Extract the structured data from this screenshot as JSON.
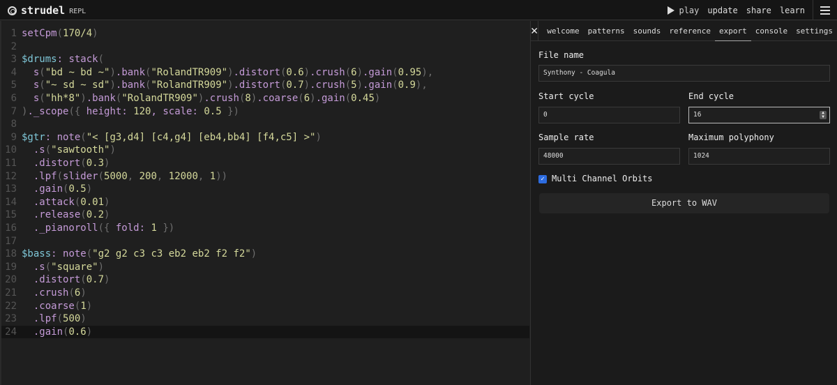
{
  "header": {
    "title": "strudel",
    "subtitle": "REPL",
    "play": "play",
    "update": "update",
    "share": "share",
    "learn": "learn"
  },
  "editor": {
    "lines": [
      [
        [
          "f",
          "setCpm"
        ],
        [
          "p",
          "("
        ],
        [
          "n",
          "170/4"
        ],
        [
          "p",
          ")"
        ]
      ],
      [],
      [
        [
          "l",
          "$drums"
        ],
        [
          "t",
          ": "
        ],
        [
          "f",
          "stack"
        ],
        [
          "p",
          "("
        ]
      ],
      [
        [
          "t",
          "  "
        ],
        [
          "f",
          "s"
        ],
        [
          "p",
          "("
        ],
        [
          "s",
          "\"bd ~ bd ~\""
        ],
        [
          "p",
          ")"
        ],
        [
          "f",
          ".bank"
        ],
        [
          "p",
          "("
        ],
        [
          "s",
          "\"RolandTR909\""
        ],
        [
          "p",
          ")"
        ],
        [
          "f",
          ".distort"
        ],
        [
          "p",
          "("
        ],
        [
          "n",
          "0.6"
        ],
        [
          "p",
          ")"
        ],
        [
          "f",
          ".crush"
        ],
        [
          "p",
          "("
        ],
        [
          "n",
          "6"
        ],
        [
          "p",
          ")"
        ],
        [
          "f",
          ".gain"
        ],
        [
          "p",
          "("
        ],
        [
          "n",
          "0.95"
        ],
        [
          "p",
          "),"
        ]
      ],
      [
        [
          "t",
          "  "
        ],
        [
          "f",
          "s"
        ],
        [
          "p",
          "("
        ],
        [
          "s",
          "\"~ sd ~ sd\""
        ],
        [
          "p",
          ")"
        ],
        [
          "f",
          ".bank"
        ],
        [
          "p",
          "("
        ],
        [
          "s",
          "\"RolandTR909\""
        ],
        [
          "p",
          ")"
        ],
        [
          "f",
          ".distort"
        ],
        [
          "p",
          "("
        ],
        [
          "n",
          "0.7"
        ],
        [
          "p",
          ")"
        ],
        [
          "f",
          ".crush"
        ],
        [
          "p",
          "("
        ],
        [
          "n",
          "5"
        ],
        [
          "p",
          ")"
        ],
        [
          "f",
          ".gain"
        ],
        [
          "p",
          "("
        ],
        [
          "n",
          "0.9"
        ],
        [
          "p",
          "),"
        ]
      ],
      [
        [
          "t",
          "  "
        ],
        [
          "f",
          "s"
        ],
        [
          "p",
          "("
        ],
        [
          "s",
          "\"hh*8\""
        ],
        [
          "p",
          ")"
        ],
        [
          "f",
          ".bank"
        ],
        [
          "p",
          "("
        ],
        [
          "s",
          "\"RolandTR909\""
        ],
        [
          "p",
          ")"
        ],
        [
          "f",
          ".crush"
        ],
        [
          "p",
          "("
        ],
        [
          "n",
          "8"
        ],
        [
          "p",
          ")"
        ],
        [
          "f",
          ".coarse"
        ],
        [
          "p",
          "("
        ],
        [
          "n",
          "6"
        ],
        [
          "p",
          ")"
        ],
        [
          "f",
          ".gain"
        ],
        [
          "p",
          "("
        ],
        [
          "n",
          "0.45"
        ],
        [
          "p",
          ")"
        ]
      ],
      [
        [
          "p",
          ")"
        ],
        [
          "f",
          "._scope"
        ],
        [
          "p",
          "({ "
        ],
        [
          "f",
          "height"
        ],
        [
          "t",
          ": "
        ],
        [
          "n",
          "120"
        ],
        [
          "t",
          ", "
        ],
        [
          "f",
          "scale"
        ],
        [
          "t",
          ": "
        ],
        [
          "n",
          "0.5"
        ],
        [
          "p",
          " })"
        ]
      ],
      [],
      [
        [
          "l",
          "$gtr"
        ],
        [
          "t",
          ": "
        ],
        [
          "f",
          "note"
        ],
        [
          "p",
          "("
        ],
        [
          "s",
          "\"< [g3,d4] [c4,g4] [eb4,bb4] [f4,c5] >\""
        ],
        [
          "p",
          ")"
        ]
      ],
      [
        [
          "t",
          "  "
        ],
        [
          "f",
          ".s"
        ],
        [
          "p",
          "("
        ],
        [
          "s",
          "\"sawtooth\""
        ],
        [
          "p",
          ")"
        ]
      ],
      [
        [
          "t",
          "  "
        ],
        [
          "f",
          ".distort"
        ],
        [
          "p",
          "("
        ],
        [
          "n",
          "0.3"
        ],
        [
          "p",
          ")"
        ]
      ],
      [
        [
          "t",
          "  "
        ],
        [
          "f",
          ".lpf"
        ],
        [
          "p",
          "("
        ],
        [
          "f",
          "slider"
        ],
        [
          "p",
          "("
        ],
        [
          "n",
          "5000"
        ],
        [
          "p",
          ", "
        ],
        [
          "n",
          "200"
        ],
        [
          "p",
          ", "
        ],
        [
          "n",
          "12000"
        ],
        [
          "p",
          ", "
        ],
        [
          "n",
          "1"
        ],
        [
          "p",
          "))"
        ]
      ],
      [
        [
          "t",
          "  "
        ],
        [
          "f",
          ".gain"
        ],
        [
          "p",
          "("
        ],
        [
          "n",
          "0.5"
        ],
        [
          "p",
          ")"
        ]
      ],
      [
        [
          "t",
          "  "
        ],
        [
          "f",
          ".attack"
        ],
        [
          "p",
          "("
        ],
        [
          "n",
          "0.01"
        ],
        [
          "p",
          ")"
        ]
      ],
      [
        [
          "t",
          "  "
        ],
        [
          "f",
          ".release"
        ],
        [
          "p",
          "("
        ],
        [
          "n",
          "0.2"
        ],
        [
          "p",
          ")"
        ]
      ],
      [
        [
          "t",
          "  "
        ],
        [
          "f",
          "._pianoroll"
        ],
        [
          "p",
          "({ "
        ],
        [
          "f",
          "fold"
        ],
        [
          "t",
          ": "
        ],
        [
          "n",
          "1"
        ],
        [
          "p",
          " })"
        ]
      ],
      [],
      [
        [
          "l",
          "$bass"
        ],
        [
          "t",
          ": "
        ],
        [
          "f",
          "note"
        ],
        [
          "p",
          "("
        ],
        [
          "s",
          "\"g2 g2 c3 c3 eb2 eb2 f2 f2\""
        ],
        [
          "p",
          ")"
        ]
      ],
      [
        [
          "t",
          "  "
        ],
        [
          "f",
          ".s"
        ],
        [
          "p",
          "("
        ],
        [
          "s",
          "\"square\""
        ],
        [
          "p",
          ")"
        ]
      ],
      [
        [
          "t",
          "  "
        ],
        [
          "f",
          ".distort"
        ],
        [
          "p",
          "("
        ],
        [
          "n",
          "0.7"
        ],
        [
          "p",
          ")"
        ]
      ],
      [
        [
          "t",
          "  "
        ],
        [
          "f",
          ".crush"
        ],
        [
          "p",
          "("
        ],
        [
          "n",
          "6"
        ],
        [
          "p",
          ")"
        ]
      ],
      [
        [
          "t",
          "  "
        ],
        [
          "f",
          ".coarse"
        ],
        [
          "p",
          "("
        ],
        [
          "n",
          "1"
        ],
        [
          "p",
          ")"
        ]
      ],
      [
        [
          "t",
          "  "
        ],
        [
          "f",
          ".lpf"
        ],
        [
          "p",
          "("
        ],
        [
          "n",
          "500"
        ],
        [
          "p",
          ")"
        ]
      ],
      [
        [
          "t",
          "  "
        ],
        [
          "f",
          ".gain"
        ],
        [
          "p",
          "("
        ],
        [
          "n",
          "0.6"
        ],
        [
          "p",
          ")"
        ]
      ]
    ]
  },
  "panel": {
    "tabs": [
      "welcome",
      "patterns",
      "sounds",
      "reference",
      "export",
      "console",
      "settings"
    ],
    "active_tab": "export",
    "file_name_label": "File name",
    "file_name": "Synthony - Coagula",
    "start_cycle_label": "Start cycle",
    "start_cycle": "0",
    "end_cycle_label": "End cycle",
    "end_cycle": "16",
    "sample_rate_label": "Sample rate",
    "sample_rate": "48000",
    "max_poly_label": "Maximum polyphony",
    "max_poly": "1024",
    "multi_channel_label": "Multi Channel Orbits",
    "multi_channel": true,
    "export_button": "Export to WAV"
  }
}
